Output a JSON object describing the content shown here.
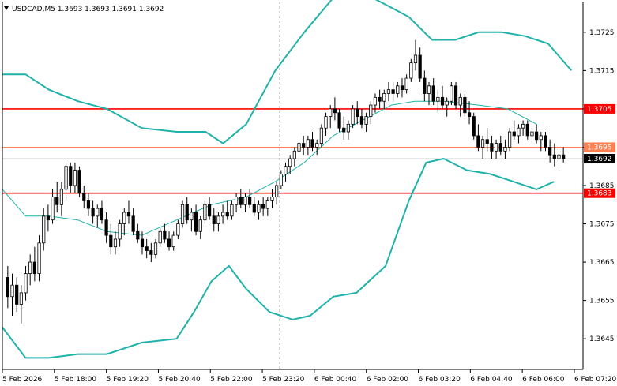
{
  "header": {
    "symbol_line": "USDCAD,M5  1.3693 1.3693 1.3691 1.3692",
    "menu_icon": "triangle-down-icon"
  },
  "colors": {
    "bollinger": "#20b2aa",
    "ma": "#20b2aa",
    "candle": "#000000",
    "level_line": "#ff0000",
    "level_line_thin": "#ff7f50",
    "price_tag_bg": "#ff0000",
    "current_price_bg": "#000000",
    "grid_separator": "#000000"
  },
  "chart_data": {
    "type": "candlestick",
    "symbol": "USDCAD",
    "timeframe": "M5",
    "ylim": [
      1.3637,
      1.3733
    ],
    "y_ticks": [
      "1.3725",
      "1.3715",
      "1.3705",
      "1.3695",
      "1.3685",
      "1.3675",
      "1.3665",
      "1.3655",
      "1.3645"
    ],
    "x_ticks": [
      "5 Feb 2026",
      "5 Feb 18:00",
      "5 Feb 19:20",
      "5 Feb 20:40",
      "5 Feb 22:00",
      "5 Feb 23:20",
      "6 Feb 00:40",
      "6 Feb 02:00",
      "6 Feb 03:20",
      "6 Feb 04:40",
      "6 Feb 06:00",
      "6 Feb 07:20"
    ],
    "levels": [
      {
        "label": "1.3705",
        "value": 1.3705,
        "style": "thick"
      },
      {
        "label": "1.3695",
        "value": 1.3695,
        "style": "thin"
      },
      {
        "label": "1.3683",
        "value": 1.3683,
        "style": "thick"
      }
    ],
    "current_price": "1.3692",
    "current_price_value": 1.3692,
    "candles": [
      [
        1.3661,
        1.3664,
        1.3653,
        1.3656
      ],
      [
        1.3656,
        1.3662,
        1.3651,
        1.3659
      ],
      [
        1.3659,
        1.3661,
        1.3652,
        1.3654
      ],
      [
        1.3654,
        1.3659,
        1.3649,
        1.3657
      ],
      [
        1.3657,
        1.3664,
        1.3655,
        1.3662
      ],
      [
        1.3662,
        1.3667,
        1.3659,
        1.3665
      ],
      [
        1.3665,
        1.3669,
        1.366,
        1.3662
      ],
      [
        1.3662,
        1.3672,
        1.366,
        1.367
      ],
      [
        1.367,
        1.3679,
        1.3668,
        1.3677
      ],
      [
        1.3677,
        1.368,
        1.3673,
        1.3676
      ],
      [
        1.3676,
        1.3684,
        1.3675,
        1.3682
      ],
      [
        1.3682,
        1.3686,
        1.3678,
        1.368
      ],
      [
        1.368,
        1.3686,
        1.3677,
        1.3684
      ],
      [
        1.3684,
        1.3691,
        1.3681,
        1.369
      ],
      [
        1.369,
        1.3691,
        1.3683,
        1.3685
      ],
      [
        1.3685,
        1.3691,
        1.3683,
        1.3689
      ],
      [
        1.3689,
        1.369,
        1.3682,
        1.3683
      ],
      [
        1.3683,
        1.3685,
        1.3679,
        1.3681
      ],
      [
        1.3681,
        1.3683,
        1.3677,
        1.3679
      ],
      [
        1.3679,
        1.3681,
        1.3675,
        1.3677
      ],
      [
        1.3677,
        1.368,
        1.3674,
        1.3679
      ],
      [
        1.3679,
        1.3681,
        1.3675,
        1.3676
      ],
      [
        1.3676,
        1.3678,
        1.367,
        1.3672
      ],
      [
        1.3672,
        1.3675,
        1.3667,
        1.3669
      ],
      [
        1.3669,
        1.3673,
        1.3667,
        1.3671
      ],
      [
        1.3671,
        1.3676,
        1.3669,
        1.3675
      ],
      [
        1.3675,
        1.3679,
        1.3672,
        1.3678
      ],
      [
        1.3678,
        1.3681,
        1.3675,
        1.3677
      ],
      [
        1.3677,
        1.3679,
        1.3672,
        1.3673
      ],
      [
        1.3673,
        1.3675,
        1.367,
        1.3671
      ],
      [
        1.3671,
        1.3673,
        1.3667,
        1.3669
      ],
      [
        1.3669,
        1.3671,
        1.3666,
        1.3668
      ],
      [
        1.3668,
        1.367,
        1.3665,
        1.3667
      ],
      [
        1.3667,
        1.3671,
        1.3666,
        1.367
      ],
      [
        1.367,
        1.3674,
        1.3669,
        1.3673
      ],
      [
        1.3673,
        1.3675,
        1.367,
        1.3671
      ],
      [
        1.3671,
        1.3673,
        1.3668,
        1.3669
      ],
      [
        1.3669,
        1.3673,
        1.3668,
        1.3672
      ],
      [
        1.3672,
        1.3676,
        1.3671,
        1.3675
      ],
      [
        1.3675,
        1.3681,
        1.3674,
        1.368
      ],
      [
        1.368,
        1.3682,
        1.3675,
        1.3676
      ],
      [
        1.3676,
        1.3679,
        1.3673,
        1.3678
      ],
      [
        1.3678,
        1.368,
        1.3672,
        1.3673
      ],
      [
        1.3673,
        1.3677,
        1.3671,
        1.3676
      ],
      [
        1.3676,
        1.3681,
        1.3675,
        1.368
      ],
      [
        1.368,
        1.3682,
        1.3676,
        1.3677
      ],
      [
        1.3677,
        1.3679,
        1.3673,
        1.3675
      ],
      [
        1.3675,
        1.3678,
        1.3673,
        1.3677
      ],
      [
        1.3677,
        1.368,
        1.3675,
        1.3678
      ],
      [
        1.3678,
        1.3681,
        1.3676,
        1.3677
      ],
      [
        1.3677,
        1.3681,
        1.3676,
        1.368
      ],
      [
        1.368,
        1.3683,
        1.3678,
        1.3682
      ],
      [
        1.3682,
        1.3684,
        1.3679,
        1.368
      ],
      [
        1.368,
        1.3683,
        1.3678,
        1.3682
      ],
      [
        1.3682,
        1.3684,
        1.3679,
        1.368
      ],
      [
        1.368,
        1.3682,
        1.3677,
        1.3678
      ],
      [
        1.3678,
        1.3681,
        1.3676,
        1.368
      ],
      [
        1.368,
        1.3682,
        1.3677,
        1.3679
      ],
      [
        1.3679,
        1.3682,
        1.3677,
        1.3681
      ],
      [
        1.3681,
        1.3684,
        1.3679,
        1.3682
      ],
      [
        1.3682,
        1.3686,
        1.368,
        1.3685
      ],
      [
        1.3685,
        1.3689,
        1.3684,
        1.3688
      ],
      [
        1.3688,
        1.3691,
        1.3686,
        1.369
      ],
      [
        1.369,
        1.3693,
        1.3688,
        1.3692
      ],
      [
        1.3692,
        1.3695,
        1.369,
        1.3694
      ],
      [
        1.3694,
        1.3697,
        1.3692,
        1.3696
      ],
      [
        1.3696,
        1.3698,
        1.3693,
        1.3695
      ],
      [
        1.3695,
        1.3698,
        1.3693,
        1.3697
      ],
      [
        1.3697,
        1.3699,
        1.3694,
        1.3695
      ],
      [
        1.3695,
        1.3697,
        1.3693,
        1.3696
      ],
      [
        1.3696,
        1.3701,
        1.3695,
        1.37
      ],
      [
        1.37,
        1.3704,
        1.3698,
        1.3703
      ],
      [
        1.3703,
        1.3706,
        1.37,
        1.3705
      ],
      [
        1.3705,
        1.3708,
        1.3702,
        1.3704
      ],
      [
        1.3704,
        1.3705,
        1.3699,
        1.37
      ],
      [
        1.37,
        1.3703,
        1.3697,
        1.3699
      ],
      [
        1.3699,
        1.3702,
        1.3697,
        1.3701
      ],
      [
        1.3701,
        1.3706,
        1.37,
        1.3705
      ],
      [
        1.3705,
        1.3707,
        1.3701,
        1.3703
      ],
      [
        1.3703,
        1.3705,
        1.37,
        1.3701
      ],
      [
        1.3701,
        1.3704,
        1.3699,
        1.3703
      ],
      [
        1.3703,
        1.3707,
        1.3701,
        1.3706
      ],
      [
        1.3706,
        1.3709,
        1.3704,
        1.3708
      ],
      [
        1.3708,
        1.371,
        1.3705,
        1.3707
      ],
      [
        1.3707,
        1.371,
        1.3705,
        1.3709
      ],
      [
        1.3709,
        1.3712,
        1.3707,
        1.371
      ],
      [
        1.371,
        1.3712,
        1.3707,
        1.3709
      ],
      [
        1.3709,
        1.3712,
        1.3708,
        1.3711
      ],
      [
        1.3711,
        1.3713,
        1.3708,
        1.371
      ],
      [
        1.371,
        1.3714,
        1.3709,
        1.3713
      ],
      [
        1.3713,
        1.3718,
        1.3712,
        1.3717
      ],
      [
        1.3717,
        1.3723,
        1.3715,
        1.3719
      ],
      [
        1.3719,
        1.3721,
        1.3712,
        1.3713
      ],
      [
        1.3713,
        1.3715,
        1.3707,
        1.3709
      ],
      [
        1.3709,
        1.3712,
        1.3706,
        1.3711
      ],
      [
        1.3711,
        1.3713,
        1.3706,
        1.3707
      ],
      [
        1.3707,
        1.371,
        1.3704,
        1.3708
      ],
      [
        1.3708,
        1.3711,
        1.3705,
        1.3706
      ],
      [
        1.3706,
        1.3708,
        1.3703,
        1.3707
      ],
      [
        1.3707,
        1.3712,
        1.3706,
        1.3711
      ],
      [
        1.3711,
        1.3712,
        1.3705,
        1.3706
      ],
      [
        1.3706,
        1.3709,
        1.3703,
        1.3708
      ],
      [
        1.3708,
        1.3709,
        1.3703,
        1.3704
      ],
      [
        1.3704,
        1.3707,
        1.3701,
        1.3703
      ],
      [
        1.3703,
        1.3704,
        1.3697,
        1.3698
      ],
      [
        1.3698,
        1.3701,
        1.3694,
        1.3695
      ],
      [
        1.3695,
        1.3698,
        1.3692,
        1.3697
      ],
      [
        1.3697,
        1.37,
        1.3694,
        1.3696
      ],
      [
        1.3696,
        1.3698,
        1.3692,
        1.3694
      ],
      [
        1.3694,
        1.3697,
        1.3692,
        1.3696
      ],
      [
        1.3696,
        1.3698,
        1.3693,
        1.3694
      ],
      [
        1.3694,
        1.3697,
        1.3692,
        1.3695
      ],
      [
        1.3695,
        1.37,
        1.3694,
        1.3699
      ],
      [
        1.3699,
        1.3702,
        1.3697,
        1.3698
      ],
      [
        1.3698,
        1.3701,
        1.3696,
        1.37
      ],
      [
        1.37,
        1.3702,
        1.3698,
        1.3701
      ],
      [
        1.3701,
        1.3702,
        1.3697,
        1.3698
      ],
      [
        1.3698,
        1.37,
        1.3696,
        1.3699
      ],
      [
        1.3699,
        1.3701,
        1.3696,
        1.3697
      ],
      [
        1.3697,
        1.3699,
        1.3694,
        1.3698
      ],
      [
        1.3698,
        1.3699,
        1.3694,
        1.3695
      ],
      [
        1.3695,
        1.3697,
        1.3691,
        1.3693
      ],
      [
        1.3693,
        1.3696,
        1.369,
        1.3692
      ],
      [
        1.3692,
        1.3694,
        1.369,
        1.3693
      ],
      [
        1.3693,
        1.3695,
        1.3691,
        1.3692
      ]
    ],
    "bollinger_upper": [
      [
        0,
        1.3714
      ],
      [
        0.04,
        1.3714
      ],
      [
        0.08,
        1.371
      ],
      [
        0.13,
        1.3707
      ],
      [
        0.18,
        1.3705
      ],
      [
        0.24,
        1.37
      ],
      [
        0.3,
        1.3699
      ],
      [
        0.35,
        1.3699
      ],
      [
        0.38,
        1.3696
      ],
      [
        0.42,
        1.3701
      ],
      [
        0.47,
        1.3715
      ],
      [
        0.52,
        1.3725
      ],
      [
        0.57,
        1.3734
      ],
      [
        0.6,
        1.3737
      ],
      [
        0.65,
        1.3733
      ],
      [
        0.7,
        1.3729
      ],
      [
        0.74,
        1.3723
      ],
      [
        0.78,
        1.3723
      ],
      [
        0.82,
        1.3725
      ],
      [
        0.86,
        1.3725
      ],
      [
        0.9,
        1.3724
      ],
      [
        0.94,
        1.3722
      ],
      [
        0.98,
        1.3715
      ]
    ],
    "bollinger_lower": [
      [
        0,
        1.3648
      ],
      [
        0.04,
        1.364
      ],
      [
        0.08,
        1.364
      ],
      [
        0.13,
        1.3641
      ],
      [
        0.18,
        1.3641
      ],
      [
        0.24,
        1.3644
      ],
      [
        0.3,
        1.3645
      ],
      [
        0.33,
        1.3652
      ],
      [
        0.36,
        1.366
      ],
      [
        0.39,
        1.3664
      ],
      [
        0.42,
        1.3658
      ],
      [
        0.46,
        1.3652
      ],
      [
        0.5,
        1.365
      ],
      [
        0.53,
        1.3651
      ],
      [
        0.57,
        1.3656
      ],
      [
        0.61,
        1.3657
      ],
      [
        0.66,
        1.3664
      ],
      [
        0.7,
        1.3681
      ],
      [
        0.73,
        1.3691
      ],
      [
        0.76,
        1.3692
      ],
      [
        0.8,
        1.3689
      ],
      [
        0.84,
        1.3688
      ],
      [
        0.88,
        1.3686
      ],
      [
        0.92,
        1.3684
      ],
      [
        0.95,
        1.3686
      ]
    ],
    "moving_average": [
      [
        0,
        1.3684
      ],
      [
        0.04,
        1.3677
      ],
      [
        0.08,
        1.3677
      ],
      [
        0.13,
        1.3676
      ],
      [
        0.18,
        1.3673
      ],
      [
        0.24,
        1.3672
      ],
      [
        0.3,
        1.3676
      ],
      [
        0.36,
        1.368
      ],
      [
        0.42,
        1.3682
      ],
      [
        0.47,
        1.3686
      ],
      [
        0.52,
        1.3691
      ],
      [
        0.57,
        1.3698
      ],
      [
        0.62,
        1.3702
      ],
      [
        0.67,
        1.3706
      ],
      [
        0.71,
        1.3707
      ],
      [
        0.76,
        1.3707
      ],
      [
        0.82,
        1.3706
      ],
      [
        0.87,
        1.3705
      ],
      [
        0.92,
        1.3701
      ]
    ]
  }
}
